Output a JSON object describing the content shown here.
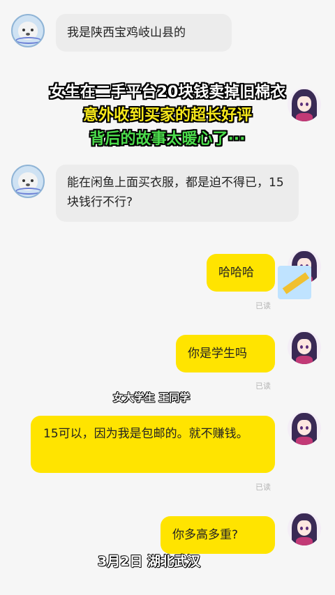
{
  "messages": [
    {
      "side": "left",
      "text": "我是陕西宝鸡岐山县的"
    },
    {
      "side": "left",
      "text": "能在闲鱼上面买衣服，都是迫不得已，15块钱行不行?"
    },
    {
      "side": "right",
      "text": "哈哈哈",
      "read": "已读"
    },
    {
      "side": "right",
      "text": "你是学生吗",
      "read": "已读"
    },
    {
      "side": "right",
      "text": "15可以，因为我是包邮的。就不赚钱。",
      "read": "已读"
    },
    {
      "side": "right",
      "text": "你多高多重?"
    }
  ],
  "overlay": {
    "line1": "女生在二手平台20块钱卖掉旧棉衣",
    "line2": "意外收到买家的超长好评",
    "line3": "背后的故事太暖心了···"
  },
  "captions": {
    "person": "女大学生  王同学",
    "date_place": "3月2日  湖北武汉"
  },
  "colors": {
    "self_bubble": "#ffe400",
    "other_bubble": "#ececec",
    "overlay_yellow": "#f7e81a",
    "overlay_green": "#4cdc4c"
  }
}
